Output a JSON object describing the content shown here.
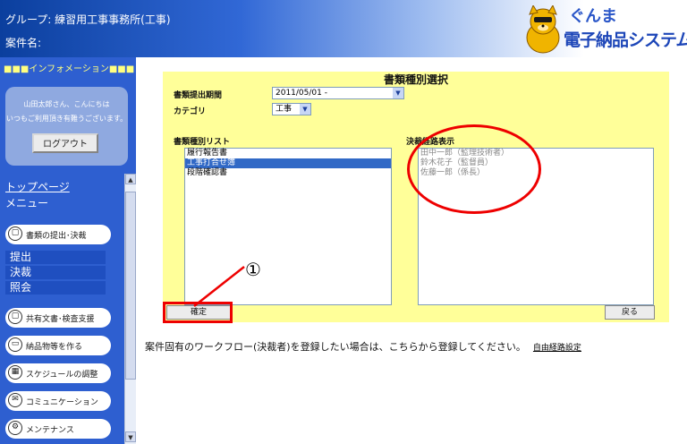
{
  "header": {
    "group_line": "グループ: 練習用工事事務所(工事)",
    "case_line": "案件名:",
    "logo_line1": "ぐんま",
    "logo_line2": "電子納品システム"
  },
  "sidebar": {
    "info_title": "■■■インフォメーション■■■",
    "greeting": "山田太郎さん、こんにちは",
    "greeting2": "いつもご利用頂き有難うございます。",
    "logout_label": "ログアウト",
    "top_link": "トップページ",
    "menu_label": "メニュー",
    "menu": {
      "submit_decide": "書類の提出･決裁",
      "shared_docs": "共有文書･検査支援",
      "deliverables": "納品物等を作る",
      "schedule": "スケジュールの調整",
      "communication": "コミュニケーション",
      "maintenance": "メンテナンス"
    },
    "subitems": {
      "submit": "提出",
      "decide": "決裁",
      "inquiry": "照会"
    }
  },
  "panel": {
    "title": "書類種別選択",
    "period_label": "書類提出期間",
    "period_value": "2011/05/01 -",
    "category_label": "カテゴリ",
    "category_value": "工事",
    "doc_list_label": "書類種別リスト",
    "doc_types": [
      "履行報告書",
      "工事打合せ簿",
      "段階確認書"
    ],
    "selected_doc_type": "工事打合せ簿",
    "route_label": "決裁経路表示",
    "route": [
      "田中一郎（監理技術者）",
      "鈴木花子（監督員）",
      "佐藤一郎（係長）"
    ],
    "confirm_label": "確定",
    "back_label": "戻る"
  },
  "annotation": {
    "callout_number": "①"
  },
  "footer": {
    "note": "案件固有のワークフロー(決裁者)を登録したい場合は、こちらから登録してください。",
    "route_setting_link": "自由経路設定"
  }
}
